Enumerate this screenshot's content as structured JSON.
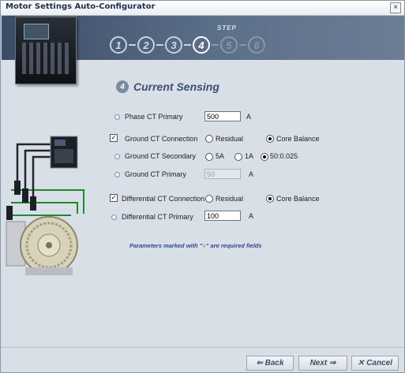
{
  "window": {
    "title": "Motor Settings Auto-Configurator",
    "close_glyph": "×"
  },
  "banner": {
    "step_label": "STEP",
    "steps": [
      {
        "label": "1",
        "state": "done"
      },
      {
        "label": "2",
        "state": "done"
      },
      {
        "label": "3",
        "state": "done"
      },
      {
        "label": "4",
        "state": "current"
      },
      {
        "label": "5",
        "state": "future"
      },
      {
        "label": "6",
        "state": "future"
      }
    ]
  },
  "section": {
    "number": "4",
    "title": "Current Sensing"
  },
  "form": {
    "phase_ct_primary": {
      "label": "Phase CT Primary",
      "value": "500",
      "unit": "A"
    },
    "ground_ct_connection": {
      "label": "Ground CT Connection",
      "checked": true,
      "options": [
        "Residual",
        "Core Balance"
      ],
      "selected": "Core Balance"
    },
    "ground_ct_secondary": {
      "label": "Ground CT Secondary",
      "options": [
        "5A",
        "1A",
        "50:0.025"
      ],
      "selected": "50:0.025"
    },
    "ground_ct_primary": {
      "label": "Ground CT Primary",
      "value": "50",
      "unit": "A",
      "disabled": true
    },
    "differential_ct_connection": {
      "label": "Differential CT Connection",
      "checked": true,
      "options": [
        "Residual",
        "Core Balance"
      ],
      "selected": "Core Balance"
    },
    "differential_ct_primary": {
      "label": "Differential CT Primary",
      "value": "100",
      "unit": "A"
    }
  },
  "note": "Parameters marked with \"○\" are required fields",
  "buttons": {
    "back": "⇐ Back",
    "next": "Next ⇒",
    "cancel": "✕ Cancel"
  },
  "colors": {
    "banner": "#4f6079",
    "accent": "#3d4f73",
    "note": "#2d4a8e"
  }
}
